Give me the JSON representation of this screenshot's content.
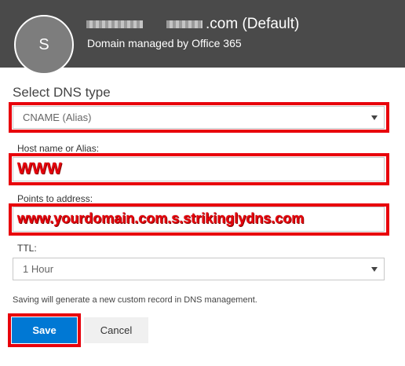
{
  "header": {
    "avatar_initial": "S",
    "domain_suffix": ".com (Default)",
    "subtitle": "Domain managed by Office 365"
  },
  "form": {
    "heading": "Select DNS type",
    "dns_type": {
      "selected": "CNAME (Alias)"
    },
    "host": {
      "label": "Host name or Alias:",
      "value": "WWW"
    },
    "points_to": {
      "label": "Points to address:",
      "value": "www.yourdomain.com.s.strikinglydns.com"
    },
    "ttl": {
      "label": "TTL:",
      "selected": "1 Hour"
    },
    "hint": "Saving will generate a new custom record in DNS management."
  },
  "actions": {
    "save_label": "Save",
    "cancel_label": "Cancel"
  },
  "colors": {
    "header_bg": "#4a4a4a",
    "highlight_red": "#e8000b",
    "primary_blue": "#0078d4"
  }
}
